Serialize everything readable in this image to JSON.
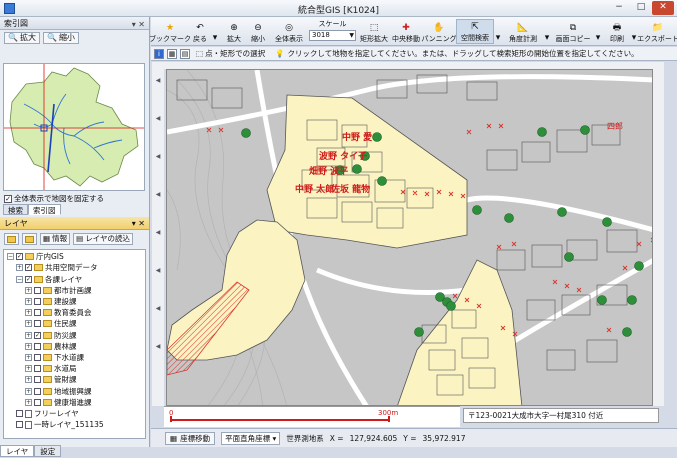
{
  "window": {
    "title": "統合型GIS [K1024]",
    "minimize": "−",
    "maximize": "□",
    "close": "✕"
  },
  "left": {
    "overview_header": "索引図",
    "zoom_in": "拡大",
    "zoom_out": "縮小",
    "fix_map_label": "全体表示で地図を固定する",
    "tabs": [
      "検索",
      "索引図"
    ],
    "layer_header": "レイヤ",
    "info_label": "情報",
    "load_layer_label": "レイヤの読込",
    "tree": [
      {
        "label": "庁内GIS",
        "indent": 0,
        "exp": "−",
        "checked": true,
        "kind": "folder"
      },
      {
        "label": "共用空間データ",
        "indent": 1,
        "exp": "+",
        "checked": true,
        "kind": "folder"
      },
      {
        "label": "各課レイヤ",
        "indent": 1,
        "exp": "−",
        "checked": true,
        "kind": "folder"
      },
      {
        "label": "都市計画課",
        "indent": 2,
        "exp": "+",
        "checked": false,
        "kind": "folder"
      },
      {
        "label": "建設課",
        "indent": 2,
        "exp": "+",
        "checked": false,
        "kind": "folder"
      },
      {
        "label": "教育委員会",
        "indent": 2,
        "exp": "+",
        "checked": false,
        "kind": "folder"
      },
      {
        "label": "住民課",
        "indent": 2,
        "exp": "+",
        "checked": false,
        "kind": "folder"
      },
      {
        "label": "防災課",
        "indent": 2,
        "exp": "+",
        "checked": true,
        "kind": "folder"
      },
      {
        "label": "農林課",
        "indent": 2,
        "exp": "+",
        "checked": false,
        "kind": "folder"
      },
      {
        "label": "下水道課",
        "indent": 2,
        "exp": "+",
        "checked": false,
        "kind": "folder"
      },
      {
        "label": "水道局",
        "indent": 2,
        "exp": "+",
        "checked": false,
        "kind": "folder"
      },
      {
        "label": "管財課",
        "indent": 2,
        "exp": "+",
        "checked": false,
        "kind": "folder"
      },
      {
        "label": "地域振興課",
        "indent": 2,
        "exp": "+",
        "checked": false,
        "kind": "folder"
      },
      {
        "label": "健康増進課",
        "indent": 2,
        "exp": "+",
        "checked": false,
        "kind": "folder"
      },
      {
        "label": "フリーレイヤ",
        "indent": 0,
        "exp": "",
        "checked": false,
        "kind": "file"
      },
      {
        "label": "一時レイヤ_151135",
        "indent": 0,
        "exp": "",
        "checked": false,
        "kind": "file"
      }
    ],
    "bottom_tabs": [
      "レイヤ",
      "設定"
    ]
  },
  "toolbar": {
    "bookmark": "ブックマーク",
    "back": "戻る",
    "zoom_in": "拡大",
    "zoom_out": "縮小",
    "full_view": "全体表示",
    "scale_label": "スケール",
    "scale_value": "3018",
    "rect_zoom": "矩形拡大",
    "center_move": "中央移動",
    "panning": "パンニング",
    "spatial_search": "空間検索",
    "angle_measure": "角度計測",
    "screen_copy": "画面コピー",
    "print": "印刷",
    "export": "エクスポート"
  },
  "infobar": {
    "mode_label": "点・矩形での選択",
    "instruction": "クリックして地物を指定してください。または、ドラッグして検索矩形の開始位置を指定してください。"
  },
  "map": {
    "owner_labels": [
      "中野 愛",
      "波野 タイ子",
      "畑野 波平",
      "中野 太郎",
      "佐坂 龍物"
    ],
    "corner_label": "四郎",
    "scale_start": "0",
    "scale_end": "300m"
  },
  "status": {
    "address": "〒123-0021大成市大字一村尾310 付近",
    "coord_move_label": "座標移動",
    "projection": "平面直角座標",
    "datum": "世界測地系",
    "x_label": "X =",
    "x_value": "127,924.605",
    "y_label": "Y =",
    "y_value": "35,972.917"
  },
  "colors": {
    "accent": "#f1cf6b",
    "highlight_area": "#fbf4c2",
    "road": "#ffffff",
    "parcel_line": "#555555",
    "marker": "#2e8f3b",
    "cross": "#d9342b",
    "label_red": "#d01b1b"
  }
}
